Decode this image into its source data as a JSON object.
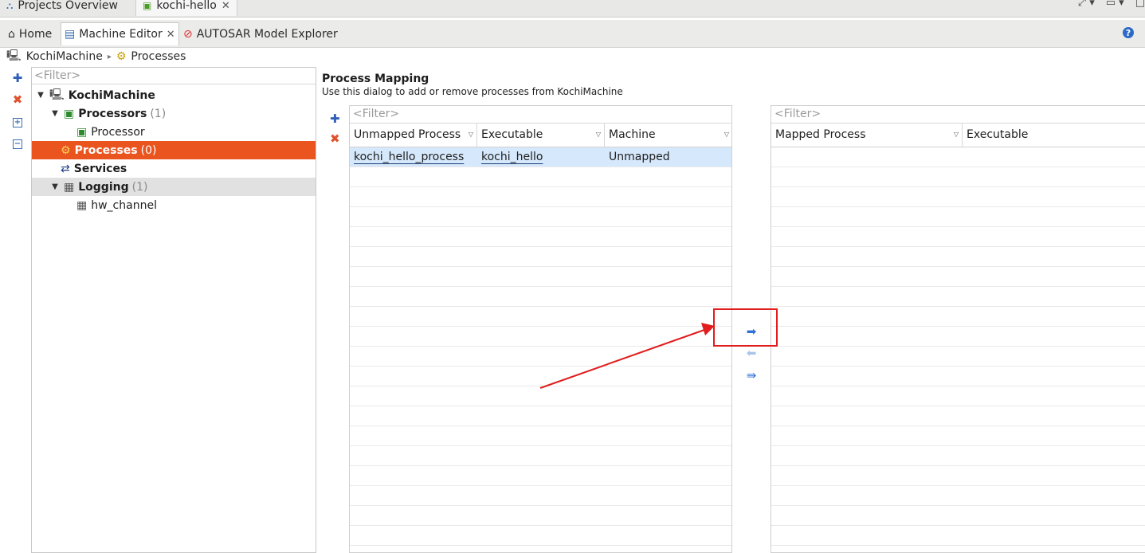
{
  "editor_tabs": [
    {
      "label": "Projects Overview"
    },
    {
      "label": "kochi-hello"
    }
  ],
  "page_tabs": {
    "home": "Home",
    "machine_editor": "Machine Editor",
    "autosar_explorer": "AUTOSAR Model Explorer"
  },
  "breadcrumb": {
    "root": "KochiMachine",
    "current": "Processes"
  },
  "tree": {
    "filter_placeholder": "<Filter>",
    "machine": "KochiMachine",
    "processors_label": "Processors",
    "processors_count": "(1)",
    "processor_item": "Processor",
    "processes_label": "Processes",
    "processes_count": "(0)",
    "services_label": "Services",
    "logging_label": "Logging",
    "logging_count": "(1)",
    "hw_channel": "hw_channel"
  },
  "mapping": {
    "title": "Process Mapping",
    "description": "Use this dialog to add or remove processes from KochiMachine"
  },
  "unmapped_table": {
    "filter_placeholder": "<Filter>",
    "columns": [
      "Unmapped Process",
      "Executable",
      "Machine"
    ],
    "rows": [
      {
        "process": "kochi_hello_process",
        "executable": "kochi_hello",
        "machine": "Unmapped"
      }
    ]
  },
  "mapped_table": {
    "filter_placeholder": "<Filter>",
    "columns": [
      "Mapped Process",
      "Executable"
    ]
  },
  "colors": {
    "selection": "#e9541f",
    "row_highlight": "#d6e8fb",
    "annotation": "#e11d1d"
  }
}
